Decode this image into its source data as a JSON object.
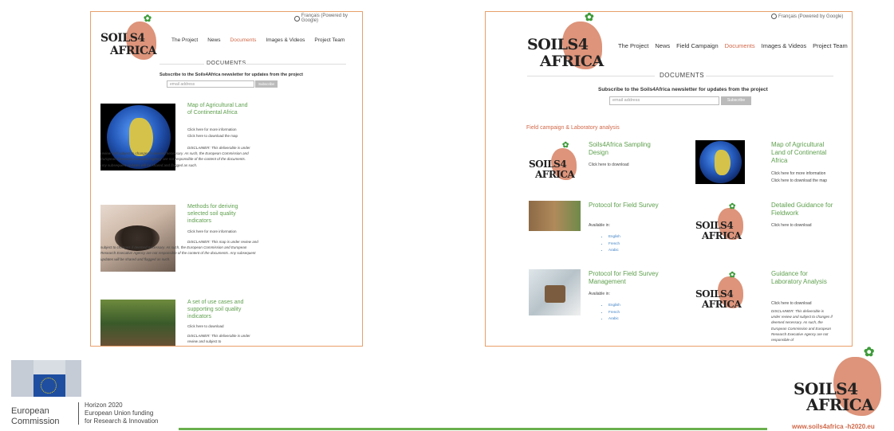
{
  "left": {
    "translate": "Français (Powered by Google)",
    "logo": {
      "word1": "SOILS4",
      "word2": "AFRICA"
    },
    "nav": [
      "The Project",
      "News",
      "Documents",
      "Images & Videos",
      "Project Team"
    ],
    "nav_active": "Documents",
    "heading": "DOCUMENTS",
    "subscribe_text": "Subscribe to the Soils4Africa newsletter for updates from the project",
    "email_placeholder": "email address",
    "subscribe_button": "Subscribe",
    "docs": [
      {
        "title": "Map of Agricultural Land of Continental Africa",
        "line1": "Click here for more information",
        "line2": "Click here to download the map",
        "disclaimer": "DISCLAIMER: This deliverable is under review and subject to changes if deemed necessary. As such, the European Commission and European Research Executive Agency are not responsible of the content of the documents. Any subsequent updates will be shared and flagged as such."
      },
      {
        "title": "Methods for deriving selected soil quality indicators",
        "line1": "Click here for more information",
        "disclaimer": "DISCLAIMER: This map is under review and subject to changes if deemed necessary. As such, the European Commission and European Research Executive Agency are not responsible of the content of the documents. Any subsequent updates will be shared and flagged as such."
      },
      {
        "title": "A set of use cases and supporting soil quality indicators",
        "line1": "Click here to download",
        "disclaimer": "DISCLAIMER: This deliverable is under review and subject to"
      }
    ]
  },
  "right": {
    "translate": "Français (Powered by Google)",
    "logo": {
      "word1": "SOILS4",
      "word2": "AFRICA"
    },
    "nav": [
      "The Project",
      "News",
      "Field Campaign",
      "Documents",
      "Images & Videos",
      "Project Team"
    ],
    "nav_active": "Documents",
    "heading": "DOCUMENTS",
    "subscribe_text": "Subscribe to the Soils4Africa newsletter for updates from the project",
    "email_placeholder": "email address",
    "subscribe_button": "Subscribe",
    "section": "Field campaign & Laboratory analysis",
    "docs": [
      {
        "title": "Soils4Africa Sampling Design",
        "line1": "Click here to download"
      },
      {
        "title": "Map of Agricultural Land of Continental Africa",
        "line1": "Click here for more information",
        "line2": "Click here to download the map"
      },
      {
        "title": "Protocol for Field Survey",
        "line1": "Available in:",
        "langs": [
          "English",
          "French",
          "Arabic"
        ]
      },
      {
        "title": "Detailed Guidance for Fieldwork",
        "line1": "Click here to download"
      },
      {
        "title": "Protocol for Field Survey Management",
        "line1": "Available in:",
        "langs": [
          "English",
          "French",
          "Arabic"
        ]
      },
      {
        "title": "Guidance for Laboratory Analysis",
        "line1": "Click here to download",
        "disclaimer": "DISCLAIMER: This deliverable is under review and subject to changes if deemed necessary. As such, the European Commission and European Research Executive Agency are not responsible of"
      }
    ]
  },
  "footer": {
    "eu_name_line1": "European",
    "eu_name_line2": "Commission",
    "funding_line1": "Horizon 2020",
    "funding_line2": "European Union funding",
    "funding_line3": "for Research & Innovation",
    "brand_word1": "SOILS4",
    "brand_word2": "AFRICA",
    "url": "www.soils4africa -h2020.eu"
  },
  "colors": {
    "accent": "#d1694a",
    "link_green": "#5fa04e",
    "border": "#e9a06a",
    "footer_line": "#6ab04c",
    "eu_blue": "#1f4ea1"
  }
}
